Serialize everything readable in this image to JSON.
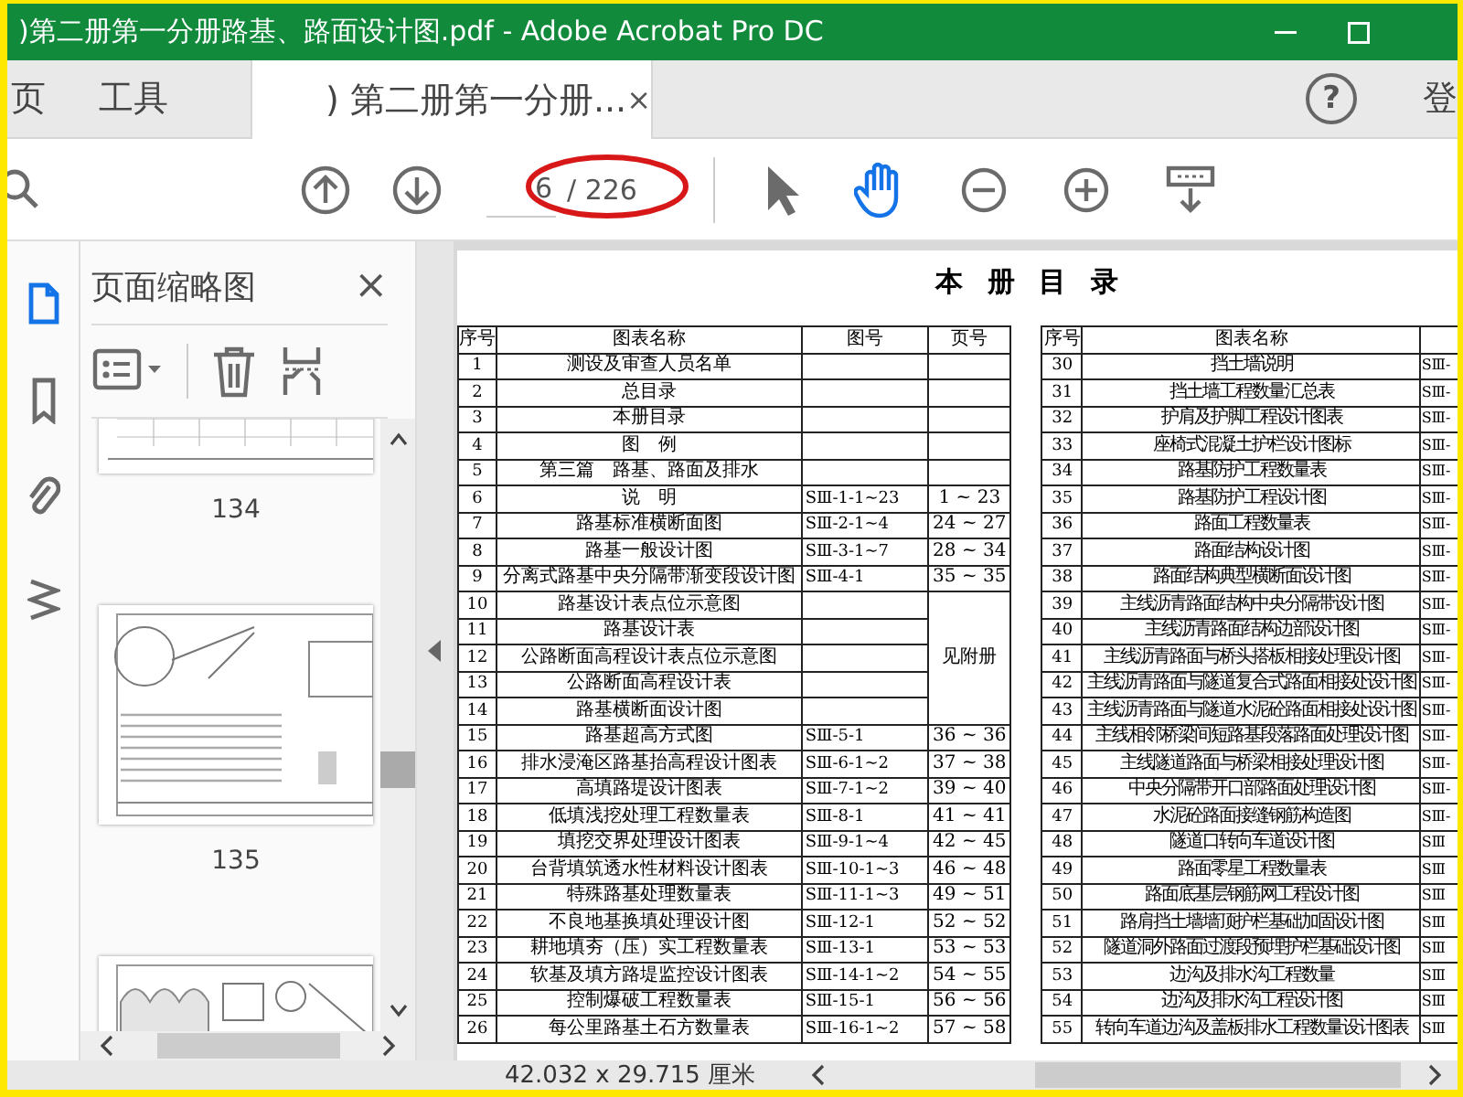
{
  "window": {
    "title": ")第二册第一分册路基、路面设计图.pdf - Adobe Acrobat Pro DC"
  },
  "tabs": [
    {
      "label": "页",
      "selected": false
    },
    {
      "label": "工具",
      "selected": false
    },
    {
      "label": ") 第二册第一分册...",
      "selected": true,
      "close": "×"
    }
  ],
  "account": {
    "help": "?",
    "sign_in": "登"
  },
  "toolbar": {
    "page": {
      "value": "6",
      "total": "/ 226"
    },
    "tools": [
      {
        "kind": "select",
        "selected": false
      },
      {
        "kind": "hand",
        "selected": true
      }
    ]
  },
  "left_rail": [
    {
      "kind": "pages",
      "selected": true
    },
    {
      "kind": "bookmarks",
      "selected": false
    },
    {
      "kind": "attachments",
      "selected": false
    },
    {
      "kind": "layers",
      "selected": false
    }
  ],
  "sidebar": {
    "title": "页面缩略图",
    "close": "×",
    "thumbnails": [
      {
        "kind": "picture",
        "label": "134"
      },
      {
        "kind": "picture",
        "label": "135"
      },
      {
        "kind": "picture"
      }
    ]
  },
  "document": {
    "title": "本 册 目 录",
    "merged_pages": "见附册",
    "left_table": {
      "columns": [
        "序号",
        "图表名称",
        "图号",
        "页号"
      ],
      "rows": [
        {
          "no": "1",
          "name": "测设及审查人员名单"
        },
        {
          "no": "2",
          "name": "总目录"
        },
        {
          "no": "3",
          "name": "本册目录"
        },
        {
          "no": "4",
          "name": "图　例"
        },
        {
          "no": "5",
          "name": "第三篇　路基、路面及排水"
        },
        {
          "no": "6",
          "name": "说　明",
          "drawing_no": "SⅢ-1-1~23",
          "pages": "1 ~ 23"
        },
        {
          "no": "7",
          "name": "路基标准横断面图",
          "drawing_no": "SⅢ-2-1~4",
          "pages": "24 ~ 27"
        },
        {
          "no": "8",
          "name": "路基一般设计图",
          "drawing_no": "SⅢ-3-1~7",
          "pages": "28 ~ 34"
        },
        {
          "no": "9",
          "name": "分离式路基中央分隔带渐变段设计图",
          "drawing_no": "SⅢ-4-1",
          "pages": "35 ~ 35"
        },
        {
          "no": "10",
          "name": "路基设计表点位示意图",
          "pages_merged": true
        },
        {
          "no": "11",
          "name": "路基设计表",
          "pages_merged": true
        },
        {
          "no": "12",
          "name": "公路断面高程设计表点位示意图",
          "pages_merged": true
        },
        {
          "no": "13",
          "name": "公路断面高程设计表",
          "pages_merged": true
        },
        {
          "no": "14",
          "name": "路基横断面设计图",
          "pages_merged": true
        },
        {
          "no": "15",
          "name": "路基超高方式图",
          "drawing_no": "SⅢ-5-1",
          "pages": "36 ~ 36"
        },
        {
          "no": "16",
          "name": "排水浸淹区路基抬高程设计图表",
          "drawing_no": "SⅢ-6-1~2",
          "pages": "37 ~ 38"
        },
        {
          "no": "17",
          "name": "高填路堤设计图表",
          "drawing_no": "SⅢ-7-1~2",
          "pages": "39 ~ 40"
        },
        {
          "no": "18",
          "name": "低填浅挖处理工程数量表",
          "drawing_no": "SⅢ-8-1",
          "pages": "41 ~ 41"
        },
        {
          "no": "19",
          "name": "填挖交界处理设计图表",
          "drawing_no": "SⅢ-9-1~4",
          "pages": "42 ~ 45"
        },
        {
          "no": "20",
          "name": "台背填筑透水性材料设计图表",
          "drawing_no": "SⅢ-10-1~3",
          "pages": "46 ~ 48"
        },
        {
          "no": "21",
          "name": "特殊路基处理数量表",
          "drawing_no": "SⅢ-11-1~3",
          "pages": "49 ~ 51"
        },
        {
          "no": "22",
          "name": "不良地基换填处理设计图",
          "drawing_no": "SⅢ-12-1",
          "pages": "52 ~ 52"
        },
        {
          "no": "23",
          "name": "耕地填夯（压）实工程数量表",
          "drawing_no": "SⅢ-13-1",
          "pages": "53 ~ 53"
        },
        {
          "no": "24",
          "name": "软基及填方路堤监控设计图表",
          "drawing_no": "SⅢ-14-1~2",
          "pages": "54 ~ 55"
        },
        {
          "no": "25",
          "name": "控制爆破工程数量表",
          "drawing_no": "SⅢ-15-1",
          "pages": "56 ~ 56"
        },
        {
          "no": "26",
          "name": "每公里路基土石方数量表",
          "drawing_no": "SⅢ-16-1~2",
          "pages": "57 ~ 58"
        }
      ]
    },
    "right_table": {
      "columns": [
        "序号",
        "图表名称"
      ],
      "rows": [
        {
          "no": "30",
          "name": "挡土墙说明",
          "column_3": "SⅢ-"
        },
        {
          "no": "31",
          "name": "挡土墙工程数量汇总表",
          "column_3": "SⅢ-"
        },
        {
          "no": "32",
          "name": "护肩及护脚工程设计图表",
          "column_3": "SⅢ-"
        },
        {
          "no": "33",
          "name": "座椅式混凝土护栏设计图标",
          "column_3": "SⅢ-"
        },
        {
          "no": "34",
          "name": "路基防护工程数量表",
          "column_3": "SⅢ-"
        },
        {
          "no": "35",
          "name": "路基防护工程设计图",
          "column_3": "SⅢ-"
        },
        {
          "no": "36",
          "name": "路面工程数量表",
          "column_3": "SⅢ-"
        },
        {
          "no": "37",
          "name": "路面结构设计图",
          "column_3": "SⅢ-"
        },
        {
          "no": "38",
          "name": "路面结构典型横断面设计图",
          "column_3": "SⅢ-"
        },
        {
          "no": "39",
          "name": "主线沥青路面结构中央分隔带设计图",
          "column_3": "SⅢ-"
        },
        {
          "no": "40",
          "name": "主线沥青路面结构边部设计图",
          "column_3": "SⅢ-"
        },
        {
          "no": "41",
          "name": "主线沥青路面与桥头搭板相接处理设计图",
          "column_3": "SⅢ-"
        },
        {
          "no": "42",
          "name": "主线沥青路面与隧道复合式路面相接处设计图",
          "column_3": "SⅢ-"
        },
        {
          "no": "43",
          "name": "主线沥青路面与隧道水泥砼路面相接处设计图",
          "column_3": "SⅢ-"
        },
        {
          "no": "44",
          "name": "主线相邻桥梁间短路基段落路面处理设计图",
          "column_3": "SⅢ-"
        },
        {
          "no": "45",
          "name": "主线隧道路面与桥梁相接处理设计图",
          "column_3": "SⅢ-"
        },
        {
          "no": "46",
          "name": "中央分隔带开口部路面处理设计图",
          "column_3": "SⅢ-"
        },
        {
          "no": "47",
          "name": "水泥砼路面接缝钢筋构造图",
          "column_3": "SⅢ-"
        },
        {
          "no": "48",
          "name": "隧道口转向车道设计图",
          "column_3": "SⅢ"
        },
        {
          "no": "49",
          "name": "路面零星工程数量表",
          "column_3": "SⅢ"
        },
        {
          "no": "50",
          "name": "路面底基层钢筋网工程设计图",
          "column_3": "SⅢ"
        },
        {
          "no": "51",
          "name": "路肩挡土墙墙顶护栏基础加固设计图",
          "column_3": "SⅢ"
        },
        {
          "no": "52",
          "name": "隧道洞外路面过渡段预埋护栏基础设计图",
          "column_3": "SⅢ"
        },
        {
          "no": "53",
          "name": "边沟及排水沟工程数量",
          "column_3": "SⅢ"
        },
        {
          "no": "54",
          "name": "边沟及排水沟工程设计图",
          "column_3": "SⅢ"
        },
        {
          "no": "55",
          "name": "转向车道边沟及盖板排水工程数量设计图表",
          "column_3": "SⅢ"
        }
      ]
    }
  },
  "status_bar": {
    "page_size": "42.032 x 29.715 厘米"
  }
}
